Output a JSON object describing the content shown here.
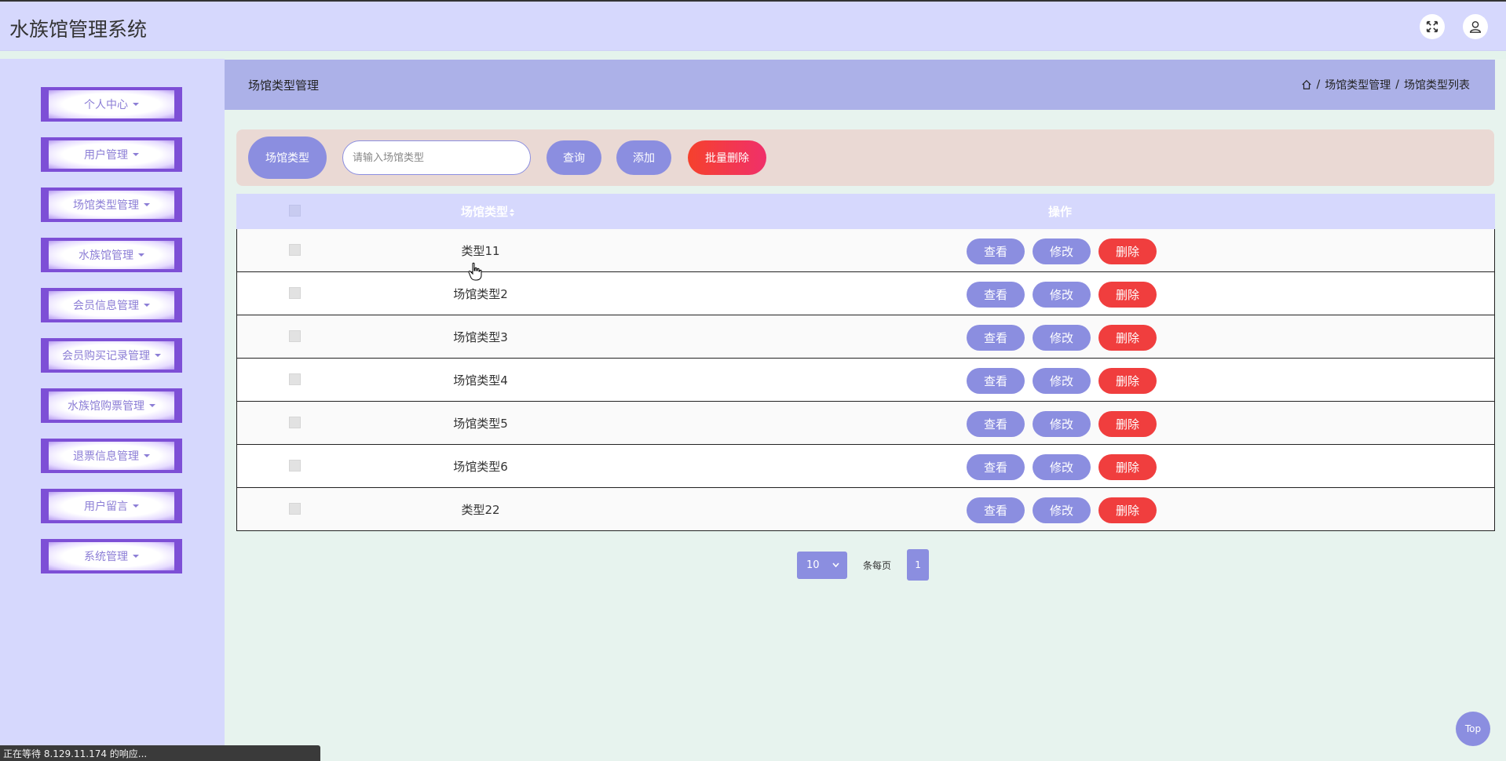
{
  "header": {
    "app_title": "水族馆管理系统"
  },
  "sidebar": {
    "items": [
      {
        "label": "个人中心"
      },
      {
        "label": "用户管理"
      },
      {
        "label": "场馆类型管理"
      },
      {
        "label": "水族馆管理"
      },
      {
        "label": "会员信息管理"
      },
      {
        "label": "会员购买记录管理"
      },
      {
        "label": "水族馆购票管理"
      },
      {
        "label": "退票信息管理"
      },
      {
        "label": "用户留言"
      },
      {
        "label": "系统管理"
      }
    ]
  },
  "page": {
    "title": "场馆类型管理",
    "breadcrumb": [
      "场馆类型管理",
      "场馆类型列表"
    ]
  },
  "search": {
    "label": "场馆类型",
    "placeholder": "请输入场馆类型",
    "query_btn": "查询",
    "add_btn": "添加",
    "batch_delete_btn": "批量删除"
  },
  "table": {
    "columns": [
      "场馆类型",
      "操作"
    ],
    "rows": [
      {
        "name": "类型11"
      },
      {
        "name": "场馆类型2"
      },
      {
        "name": "场馆类型3"
      },
      {
        "name": "场馆类型4"
      },
      {
        "name": "场馆类型5"
      },
      {
        "name": "场馆类型6"
      },
      {
        "name": "类型22"
      }
    ],
    "actions": {
      "view": "查看",
      "edit": "修改",
      "delete": "删除"
    }
  },
  "pagination": {
    "page_size": "10",
    "per_page_label": "条每页",
    "current_page": "1"
  },
  "top_button": "Top",
  "status_bar": "正在等待 8.129.11.174 的响应...",
  "colors": {
    "header_bg": "#d6d8fd",
    "accent": "#8b8ee0",
    "danger": "#f03e3e",
    "menu_border": "#7d4fd6"
  }
}
